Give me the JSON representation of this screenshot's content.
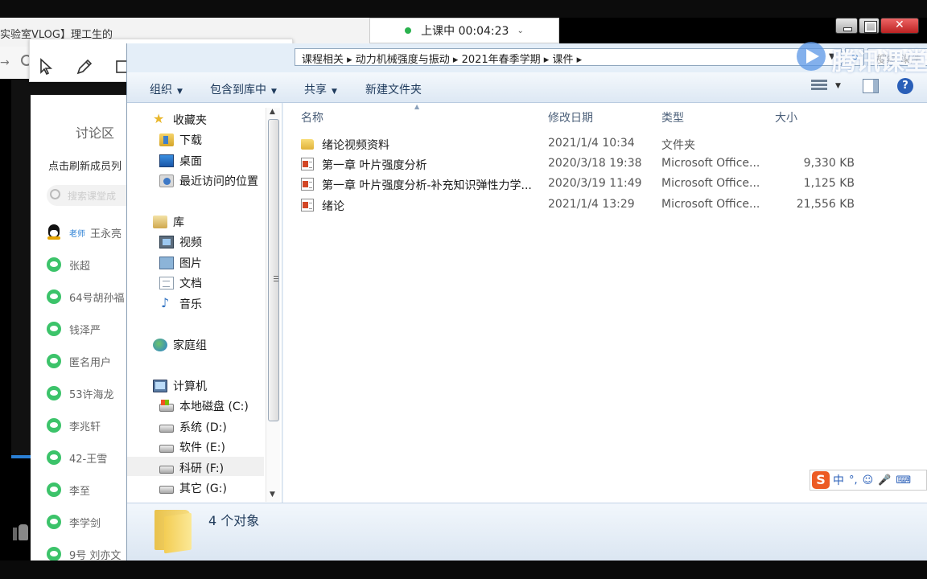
{
  "background_app": {
    "title": "实验室VLOG】理工生的"
  },
  "classroom": {
    "status": "上课中 00:04:23",
    "watermark": "腾讯课堂"
  },
  "discussion": {
    "title": "讨论区",
    "refresh": "点击刷新成员列",
    "search_placeholder": "搜索课堂成",
    "members": [
      {
        "tag": "老师",
        "name": "王永亮",
        "type": "teacher"
      },
      {
        "name": "张超"
      },
      {
        "name": "64号胡孙福"
      },
      {
        "name": "钱泽严"
      },
      {
        "name": "匿名用户"
      },
      {
        "name": "53许海龙"
      },
      {
        "name": "李兆轩"
      },
      {
        "name": "42-王雪"
      },
      {
        "name": "李至"
      },
      {
        "name": "李学剑"
      },
      {
        "name": "9号 刘亦文"
      }
    ]
  },
  "explorer": {
    "breadcrumb": "课程相关 ▸ 动力机械强度与振动 ▸ 2021年春季学期 ▸ 课件 ▸",
    "search_placeholder": "搜索 课件",
    "commands": {
      "organize": "组织",
      "include": "包含到库中",
      "share": "共享",
      "new_folder": "新建文件夹"
    },
    "nav": {
      "favorites": "收藏夹",
      "downloads": "下载",
      "desktop": "桌面",
      "recent": "最近访问的位置",
      "libraries": "库",
      "videos": "视频",
      "pictures": "图片",
      "documents": "文档",
      "music": "音乐",
      "homegroup": "家庭组",
      "computer": "计算机",
      "drives": [
        "本地磁盘 (C:)",
        "系统 (D:)",
        "软件 (E:)",
        "科研 (F:)",
        "其它 (G:)"
      ]
    },
    "columns": {
      "name": "名称",
      "modified": "修改日期",
      "type": "类型",
      "size": "大小"
    },
    "files": [
      {
        "name": "绪论视频资料",
        "date": "2021/1/4 10:34",
        "type": "文件夹",
        "size": "",
        "icon": "folder-icon"
      },
      {
        "name": "第一章 叶片强度分析",
        "date": "2020/3/18 19:38",
        "type": "Microsoft Office...",
        "size": "9,330 KB",
        "icon": "powerpoint-file-icon"
      },
      {
        "name": "第一章 叶片强度分析-补充知识弹性力学...",
        "date": "2020/3/19 11:49",
        "type": "Microsoft Office...",
        "size": "1,125 KB",
        "icon": "powerpoint-file-icon"
      },
      {
        "name": "绪论",
        "date": "2021/1/4 13:29",
        "type": "Microsoft Office...",
        "size": "21,556 KB",
        "icon": "powerpoint-file-icon"
      }
    ],
    "object_count": "4 个对象"
  },
  "ime": {
    "mode": "中",
    "punct": "°,"
  }
}
